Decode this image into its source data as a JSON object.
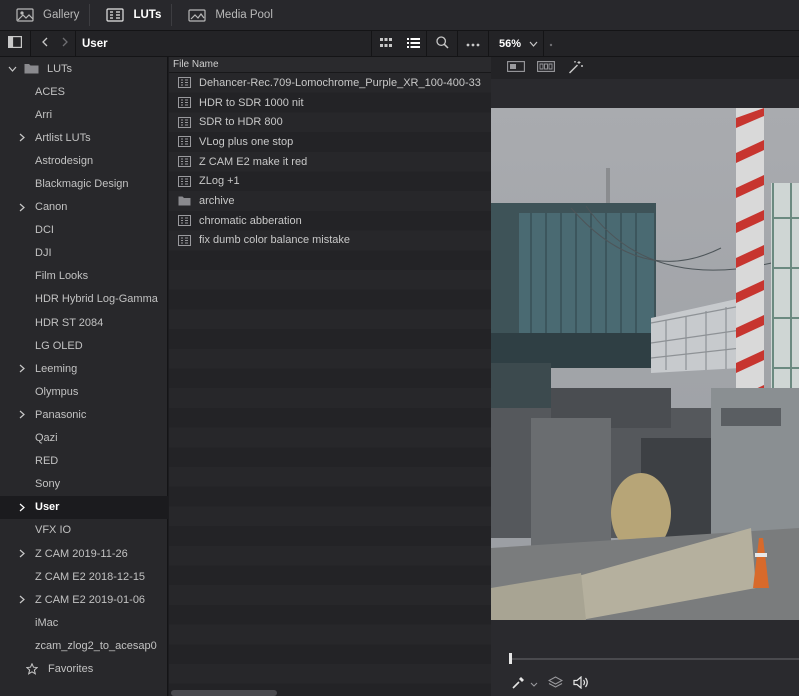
{
  "tabs": [
    {
      "label": "Gallery",
      "icon": "gallery-icon"
    },
    {
      "label": "LUTs",
      "icon": "luts-icon",
      "active": true
    },
    {
      "label": "Media Pool",
      "icon": "media-pool-icon"
    }
  ],
  "toolbar": {
    "path_title": "User",
    "zoom": "56%"
  },
  "sidebar": {
    "root": "LUTs",
    "items": [
      {
        "label": "ACES",
        "expandable": false
      },
      {
        "label": "Arri",
        "expandable": false
      },
      {
        "label": "Artlist LUTs",
        "expandable": true
      },
      {
        "label": "Astrodesign",
        "expandable": false
      },
      {
        "label": "Blackmagic Design",
        "expandable": false
      },
      {
        "label": "Canon",
        "expandable": true
      },
      {
        "label": "DCI",
        "expandable": false
      },
      {
        "label": "DJI",
        "expandable": false
      },
      {
        "label": "Film Looks",
        "expandable": false
      },
      {
        "label": "HDR Hybrid Log-Gamma",
        "expandable": false
      },
      {
        "label": "HDR ST 2084",
        "expandable": false
      },
      {
        "label": "LG OLED",
        "expandable": false
      },
      {
        "label": "Leeming",
        "expandable": true
      },
      {
        "label": "Olympus",
        "expandable": false
      },
      {
        "label": "Panasonic",
        "expandable": true
      },
      {
        "label": "Qazi",
        "expandable": false
      },
      {
        "label": "RED",
        "expandable": false
      },
      {
        "label": "Sony",
        "expandable": false
      },
      {
        "label": "User",
        "expandable": true,
        "selected": true
      },
      {
        "label": "VFX IO",
        "expandable": false
      },
      {
        "label": "Z CAM 2019-11-26",
        "expandable": true
      },
      {
        "label": "Z CAM E2 2018-12-15",
        "expandable": false
      },
      {
        "label": "Z CAM E2 2019-01-06",
        "expandable": true
      },
      {
        "label": "iMac",
        "expandable": false
      },
      {
        "label": "zcam_zlog2_to_acesap0",
        "expandable": false
      }
    ],
    "favorites": "Favorites"
  },
  "filelist": {
    "header": "File Name",
    "files": [
      {
        "name": "Dehancer-Rec.709-Lomochrome_Purple_XR_100-400-33",
        "type": "lut"
      },
      {
        "name": "HDR to SDR 1000 nit",
        "type": "lut"
      },
      {
        "name": "SDR to HDR 800",
        "type": "lut"
      },
      {
        "name": "VLog plus one stop",
        "type": "lut"
      },
      {
        "name": "Z CAM E2 make it red",
        "type": "lut"
      },
      {
        "name": "ZLog +1",
        "type": "lut"
      },
      {
        "name": "archive",
        "type": "folder"
      },
      {
        "name": "chromatic abberation",
        "type": "lut"
      },
      {
        "name": "fix dumb color balance mistake",
        "type": "lut"
      }
    ]
  },
  "viewer": {
    "playhead_position": 0
  },
  "colors": {
    "background": "#1c1c1f",
    "panel": "#28282b",
    "selected_row": "#1b1b1e",
    "text": "#c8c8c8"
  }
}
